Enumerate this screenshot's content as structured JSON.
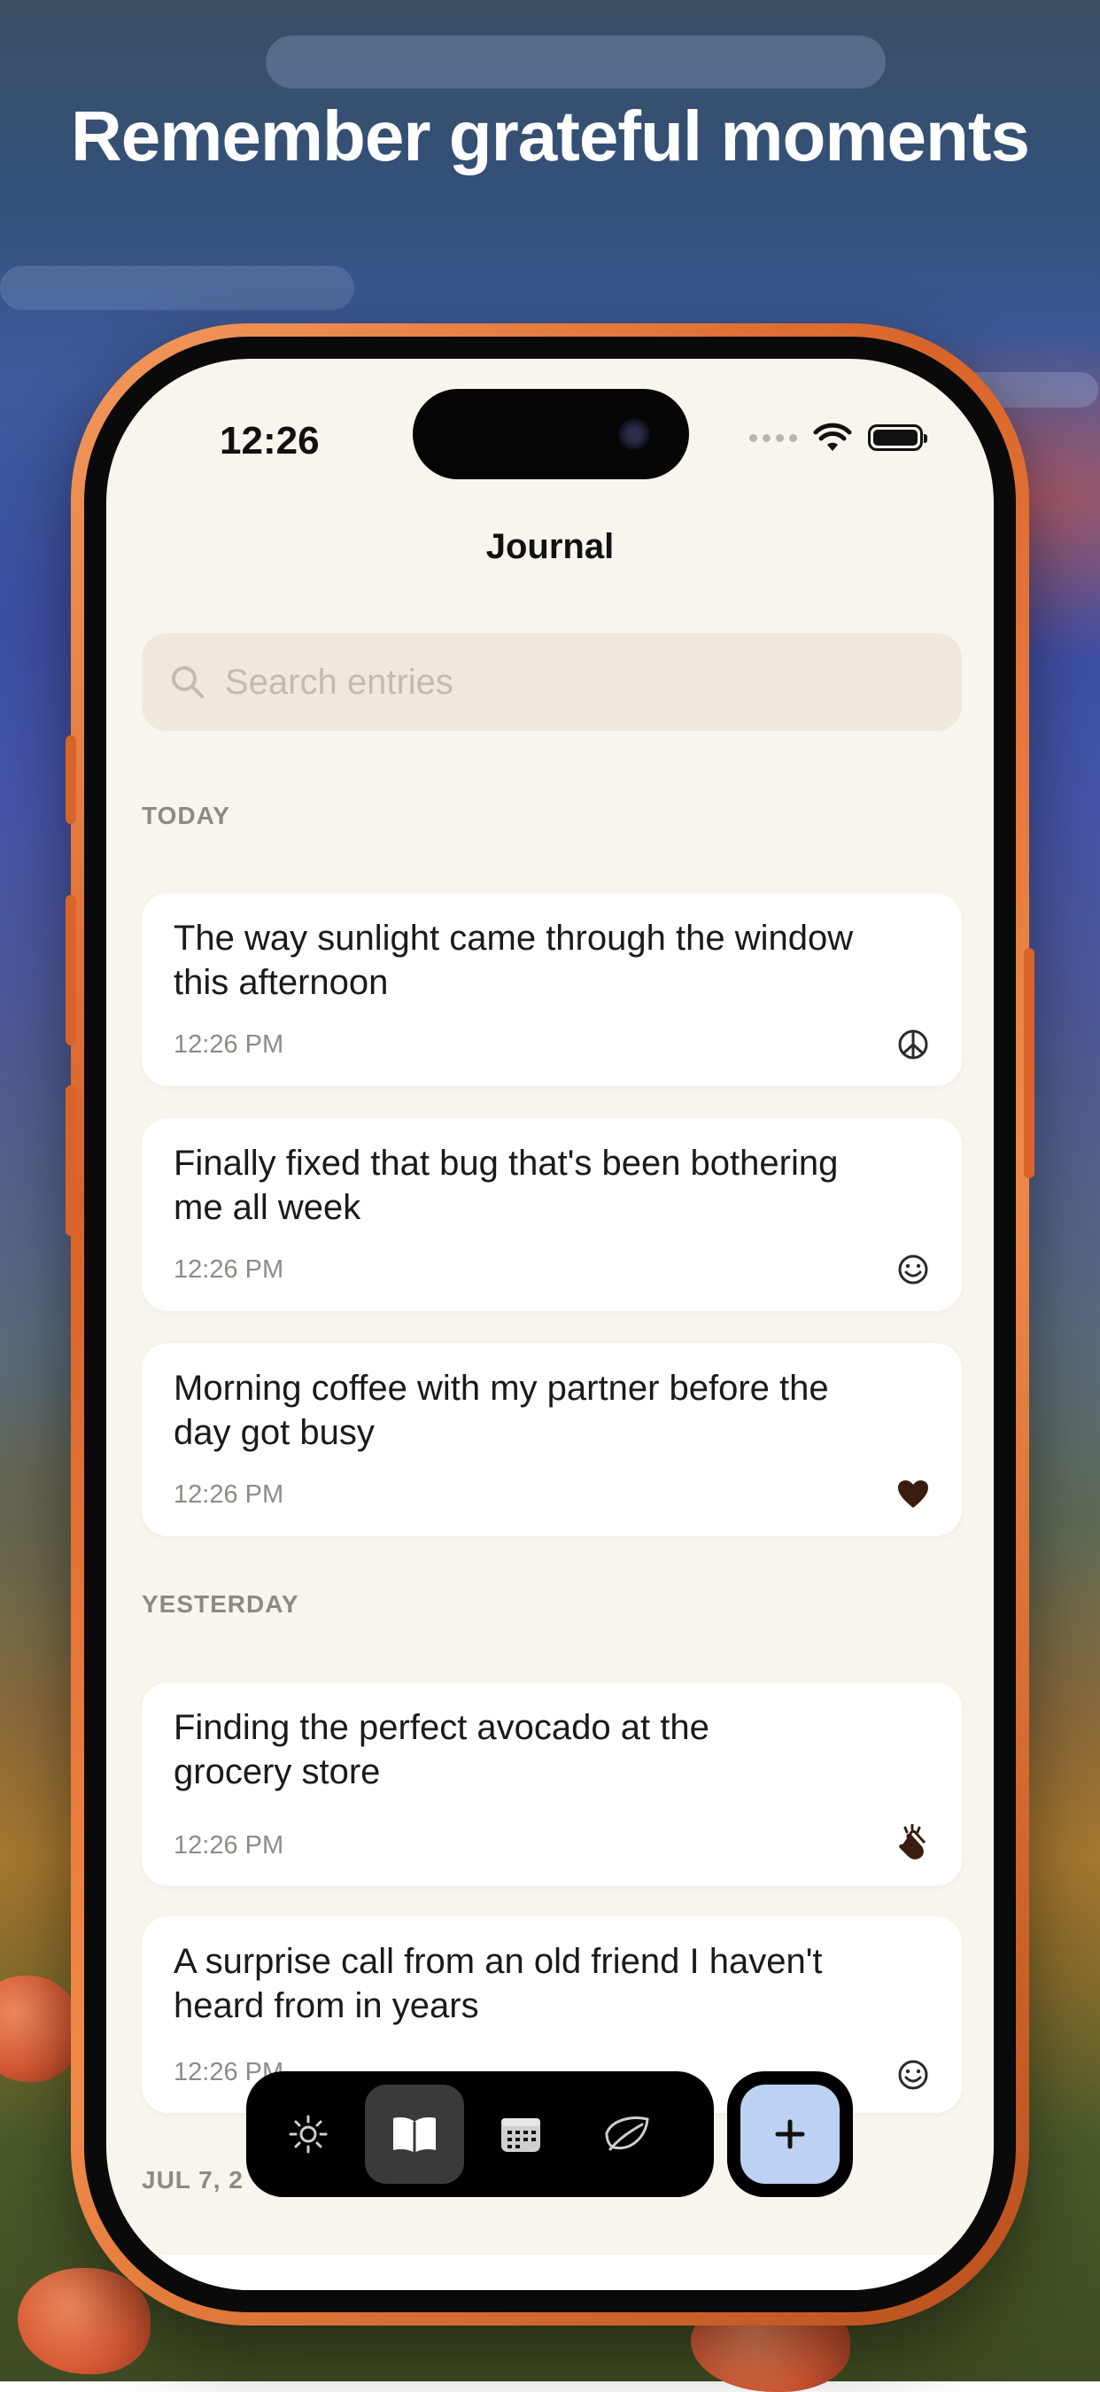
{
  "headline": "Remember grateful moments",
  "status_bar": {
    "time": "12:26"
  },
  "nav": {
    "title": "Journal"
  },
  "search": {
    "placeholder": "Search entries"
  },
  "sections": [
    {
      "label": "TODAY",
      "entries": [
        {
          "line1": "The way sunlight came through the window",
          "line2": "this afternoon",
          "time": "12:26 PM",
          "mood_icon": "peace-icon"
        },
        {
          "line1": "Finally fixed that bug that's been bothering",
          "line2": "me all week",
          "time": "12:26 PM",
          "mood_icon": "smile-icon"
        },
        {
          "line1": "Morning coffee with my partner before the",
          "line2": "day got busy",
          "time": "12:26 PM",
          "mood_icon": "heart-icon"
        }
      ]
    },
    {
      "label": "YESTERDAY",
      "entries": [
        {
          "line1": "Finding the perfect avocado at the",
          "line2": "grocery store",
          "time": "12:26 PM",
          "mood_icon": "clapping-hands-icon"
        },
        {
          "line1": "A surprise call from an old friend I haven't",
          "line2": "heard from in years",
          "time": "12:26 PM",
          "mood_icon": "smile-icon"
        }
      ]
    },
    {
      "label": "JUL 7, 2"
    }
  ],
  "tab_bar": {
    "tabs": [
      {
        "icon": "sun-icon",
        "active": false
      },
      {
        "icon": "book-icon",
        "active": true
      },
      {
        "icon": "calendar-icon",
        "active": false
      },
      {
        "icon": "leaf-icon",
        "active": false
      }
    ],
    "add_button_icon": "plus-icon"
  },
  "colors": {
    "screen_bg": "#f8f5ee",
    "search_bg": "#efe8dc",
    "fab": "#bcd2f2",
    "phone_frame": "#e0743a"
  }
}
